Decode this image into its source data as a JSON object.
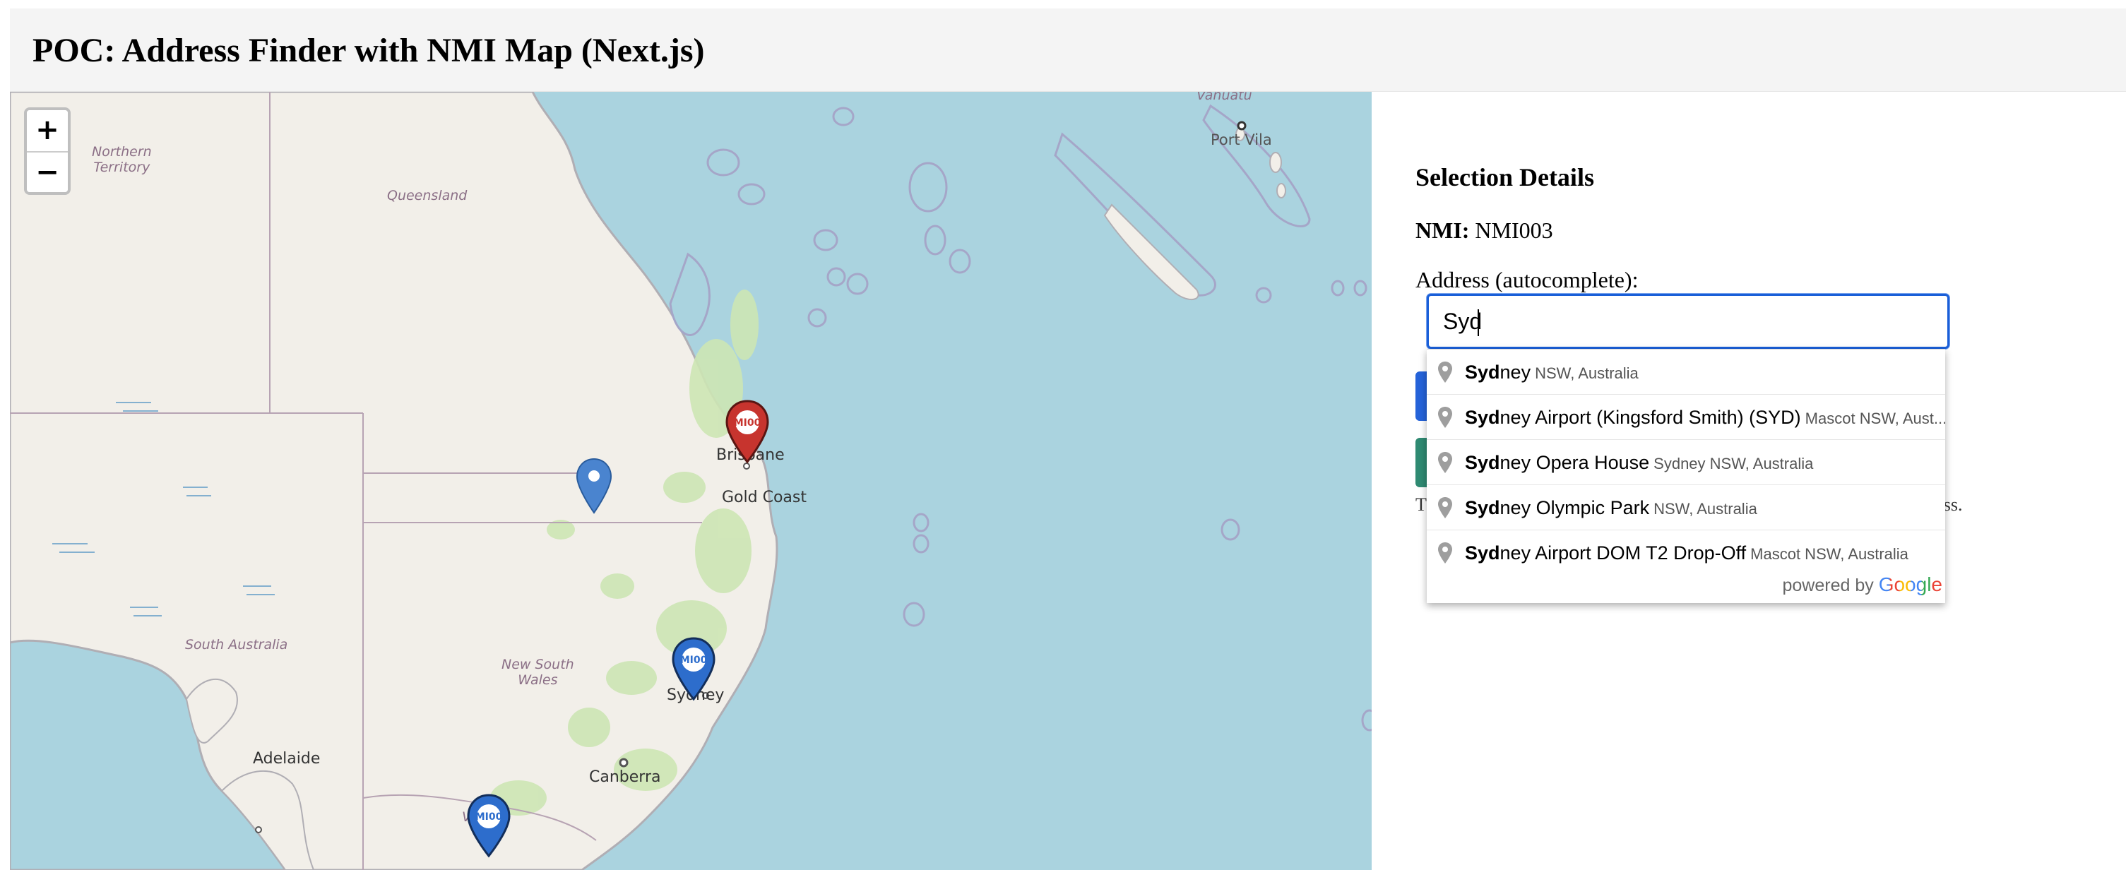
{
  "header": {
    "title": "POC: Address Finder with NMI Map (Next.js)"
  },
  "map": {
    "zoom_in_label": "+",
    "zoom_out_label": "−",
    "labels": {
      "northern_territory_1": "Northern",
      "northern_territory_2": "Territory",
      "queensland": "Queensland",
      "vanuatu": "Vanuatu",
      "port_vila": "Port Vila",
      "brisbane": "Brisbane",
      "gold_coast": "Gold Coast",
      "south_australia": "South Australia",
      "nsw_1": "New South",
      "nsw_2": "Wales",
      "sydney": "Sydney",
      "adelaide": "Adelaide",
      "canberra": "Canberra",
      "victoria": "Vic"
    },
    "marker_text": "MI00",
    "colors": {
      "water": "#aad3df",
      "land": "#f2efe9",
      "vegetation": "#cde6b4",
      "marker_red": "#c7342e",
      "marker_blue": "#2d6dcc",
      "marker_plain": "#4a84cf"
    }
  },
  "panel": {
    "heading": "Selection Details",
    "nmi_label": "NMI:",
    "nmi_value": "NMI003",
    "address_label": "Address (autocomplete):",
    "address_value": "Syd",
    "hint_start": "T",
    "hint_end": "address."
  },
  "suggestions": {
    "items": [
      {
        "match": "Syd",
        "rest": "ney",
        "secondary": "NSW, Australia"
      },
      {
        "match": "Syd",
        "rest": "ney Airport (Kingsford Smith) (SYD)",
        "secondary": "Mascot NSW, Aust..."
      },
      {
        "match": "Syd",
        "rest": "ney Opera House",
        "secondary": "Sydney NSW, Australia"
      },
      {
        "match": "Syd",
        "rest": "ney Olympic Park",
        "secondary": "NSW, Australia"
      },
      {
        "match": "Syd",
        "rest": "ney Airport DOM T2 Drop-Off",
        "secondary": "Mascot NSW, Australia"
      }
    ],
    "powered_by": "powered by",
    "brand": "Google"
  }
}
